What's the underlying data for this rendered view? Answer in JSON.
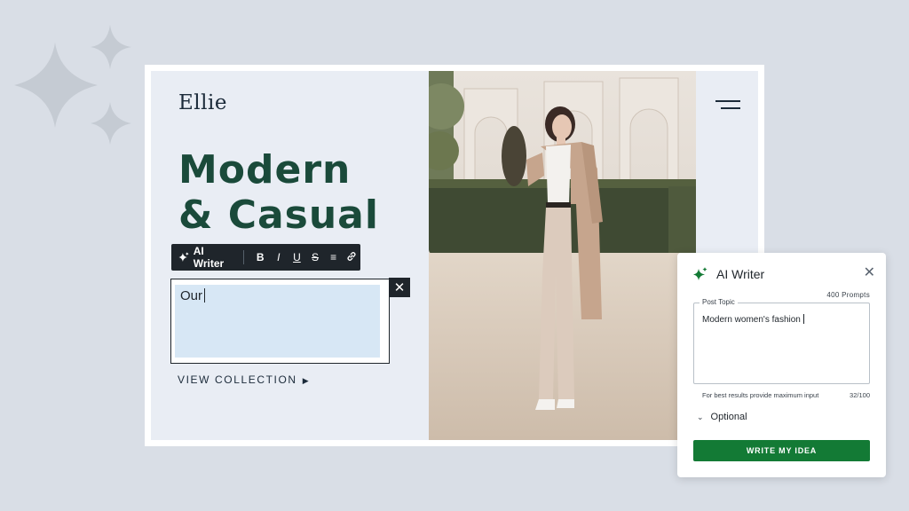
{
  "site": {
    "logo": "Ellie",
    "hero_title": "Modern\n& Casual",
    "view_collection": "VIEW COLLECTION"
  },
  "toolbar": {
    "ai_writer_label": "AI Writer",
    "buttons": [
      {
        "name": "bold",
        "glyph": "B"
      },
      {
        "name": "italic",
        "glyph": "I"
      },
      {
        "name": "underline",
        "glyph": "U"
      },
      {
        "name": "strikethrough",
        "glyph": "S"
      },
      {
        "name": "align",
        "glyph": "≡"
      },
      {
        "name": "link",
        "glyph": "⛓"
      }
    ]
  },
  "editor": {
    "text": "Our"
  },
  "panel": {
    "title": "AI Writer",
    "prompts": "400 Prompts",
    "topic_label": "Post Topic",
    "topic_value": "Modern women's fashion",
    "hint": "For best results provide maximum input",
    "counter": "32/100",
    "optional": "Optional",
    "submit": "WRITE MY IDEA"
  },
  "colors": {
    "background": "#d9dee6",
    "hero": "#1a4a3a",
    "accent_button": "#137a35",
    "toolbar": "#1f252b",
    "editor_fill": "#d7e7f5"
  },
  "icons": [
    "sparkle-icon",
    "menu-icon",
    "close-icon",
    "chevron-down-icon",
    "play-triangle-icon",
    "link-icon"
  ]
}
